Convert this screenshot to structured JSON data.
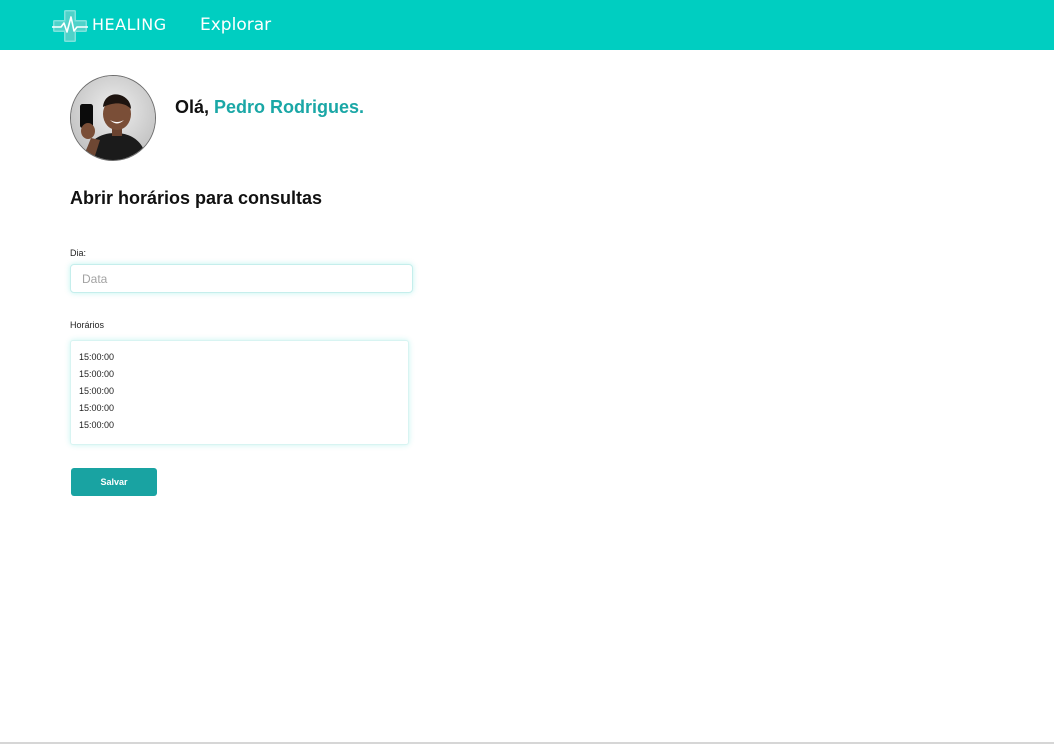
{
  "navbar": {
    "brand": "HEALING",
    "explore_label": "Explorar",
    "color": "#00cec1"
  },
  "profile": {
    "greeting_prefix": "Olá, ",
    "user_name": "Pedro Rodrigues.",
    "name_color": "#1aa7a6"
  },
  "form": {
    "title": "Abrir horários para consultas",
    "day_label": "Dia:",
    "day_placeholder": "Data",
    "day_value": "",
    "times_label": "Horários",
    "times": [
      "15:00:00",
      "15:00:00",
      "15:00:00",
      "15:00:00",
      "15:00:00"
    ],
    "save_label": "Salvar",
    "button_color": "#19a3a2"
  },
  "icons": {
    "logo": "medical-cross-heartbeat-icon"
  }
}
